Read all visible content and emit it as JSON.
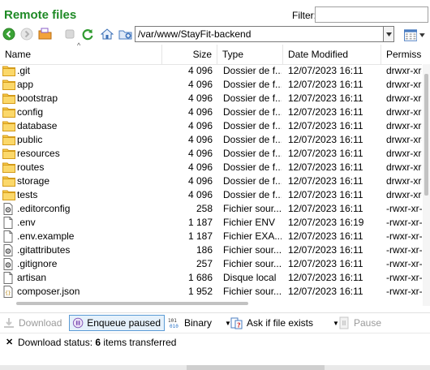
{
  "panel": {
    "title": "Remote files",
    "filter_label": "Filter:",
    "filter_value": ""
  },
  "nav": {
    "path": "/var/www/StayFit-backend"
  },
  "columns": {
    "name": "Name",
    "size": "Size",
    "type": "Type",
    "date": "Date Modified",
    "perm": "Permissi"
  },
  "files": [
    {
      "name": ".git",
      "size": "4 096",
      "type": "Dossier de f...",
      "date": "12/07/2023 16:11",
      "perm": "drwxr-xr-",
      "icon": "folder-icon"
    },
    {
      "name": "app",
      "size": "4 096",
      "type": "Dossier de f...",
      "date": "12/07/2023 16:11",
      "perm": "drwxr-xr-",
      "icon": "folder-icon"
    },
    {
      "name": "bootstrap",
      "size": "4 096",
      "type": "Dossier de f...",
      "date": "12/07/2023 16:11",
      "perm": "drwxr-xr-",
      "icon": "folder-icon"
    },
    {
      "name": "config",
      "size": "4 096",
      "type": "Dossier de f...",
      "date": "12/07/2023 16:11",
      "perm": "drwxr-xr-",
      "icon": "folder-icon"
    },
    {
      "name": "database",
      "size": "4 096",
      "type": "Dossier de f...",
      "date": "12/07/2023 16:11",
      "perm": "drwxr-xr-",
      "icon": "folder-icon"
    },
    {
      "name": "public",
      "size": "4 096",
      "type": "Dossier de f...",
      "date": "12/07/2023 16:11",
      "perm": "drwxr-xr-",
      "icon": "folder-icon"
    },
    {
      "name": "resources",
      "size": "4 096",
      "type": "Dossier de f...",
      "date": "12/07/2023 16:11",
      "perm": "drwxr-xr-",
      "icon": "folder-icon"
    },
    {
      "name": "routes",
      "size": "4 096",
      "type": "Dossier de f...",
      "date": "12/07/2023 16:11",
      "perm": "drwxr-xr-",
      "icon": "folder-icon"
    },
    {
      "name": "storage",
      "size": "4 096",
      "type": "Dossier de f...",
      "date": "12/07/2023 16:11",
      "perm": "drwxr-xr-",
      "icon": "folder-icon"
    },
    {
      "name": "tests",
      "size": "4 096",
      "type": "Dossier de f...",
      "date": "12/07/2023 16:11",
      "perm": "drwxr-xr-",
      "icon": "folder-icon"
    },
    {
      "name": ".editorconfig",
      "size": "258",
      "type": "Fichier sour...",
      "date": "12/07/2023 16:11",
      "perm": "-rwxr-xr-",
      "icon": "config-file-icon"
    },
    {
      "name": ".env",
      "size": "1 187",
      "type": "Fichier ENV",
      "date": "12/07/2023 16:19",
      "perm": "-rwxr-xr-",
      "icon": "file-icon"
    },
    {
      "name": ".env.example",
      "size": "1 187",
      "type": "Fichier EXA...",
      "date": "12/07/2023 16:11",
      "perm": "-rwxr-xr-",
      "icon": "file-icon"
    },
    {
      "name": ".gitattributes",
      "size": "186",
      "type": "Fichier sour...",
      "date": "12/07/2023 16:11",
      "perm": "-rwxr-xr-",
      "icon": "config-file-icon"
    },
    {
      "name": ".gitignore",
      "size": "257",
      "type": "Fichier sour...",
      "date": "12/07/2023 16:11",
      "perm": "-rwxr-xr-",
      "icon": "config-file-icon"
    },
    {
      "name": "artisan",
      "size": "1 686",
      "type": "Disque local",
      "date": "12/07/2023 16:11",
      "perm": "-rwxr-xr-",
      "icon": "file-icon"
    },
    {
      "name": "composer.json",
      "size": "1 952",
      "type": "Fichier sour...",
      "date": "12/07/2023 16:11",
      "perm": "-rwxr-xr-",
      "icon": "json-file-icon"
    }
  ],
  "toolbar": {
    "download": "Download",
    "enqueue": "Enqueue paused",
    "binary": "Binary",
    "ask": "Ask if file exists",
    "pause": "Pause"
  },
  "status": {
    "prefix": "Download status: ",
    "count": "6",
    "suffix": " items transferred"
  },
  "colors": {
    "title_green": "#1e8a25",
    "folder_yellow": "#f7c948"
  }
}
